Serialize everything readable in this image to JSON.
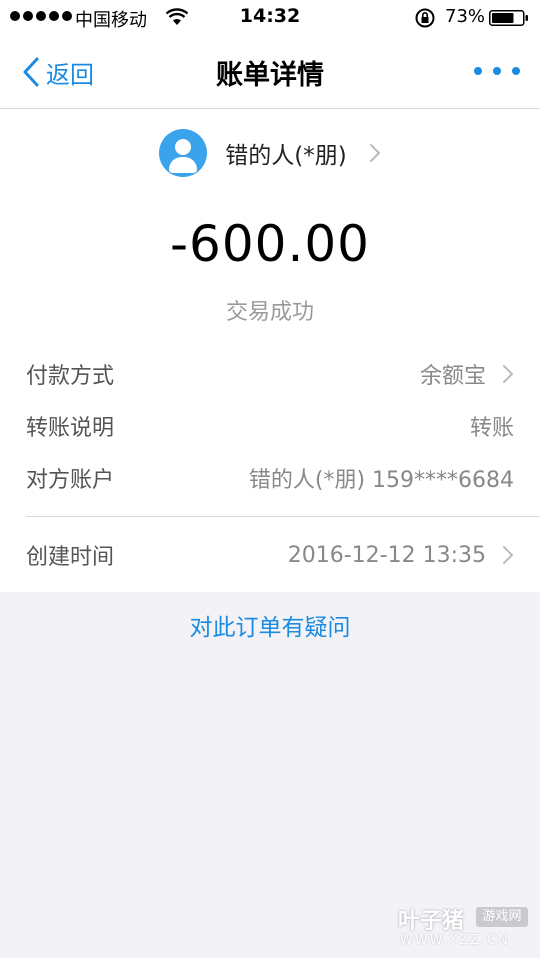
{
  "status_bar": {
    "carrier": "中国移动",
    "time": "14:32",
    "battery_percent": "73%",
    "battery_level": 0.73
  },
  "nav": {
    "back_label": "返回",
    "title": "账单详情",
    "more_icon": "more-dots-icon"
  },
  "payee": {
    "name": "错的人(*朋)",
    "avatar_icon": "user-avatar-icon"
  },
  "transaction": {
    "amount": "-600.00",
    "status": "交易成功"
  },
  "details": [
    {
      "label": "付款方式",
      "value": "余额宝"
    },
    {
      "label": "转账说明",
      "value": "转账"
    },
    {
      "label": "对方账户",
      "value": "错的人(*朋) 159****6684"
    },
    {
      "label": "创建时间",
      "value": "2016-12-12 13:35"
    }
  ],
  "question_link": "对此订单有疑问",
  "watermark": {
    "brand": "叶子猪",
    "badge": "游戏网",
    "url": "WWW.YZZ.CN"
  },
  "colors": {
    "accent": "#1a8be0",
    "avatar_bg": "#3aa3ec",
    "page_bg": "#f3f3f7"
  }
}
